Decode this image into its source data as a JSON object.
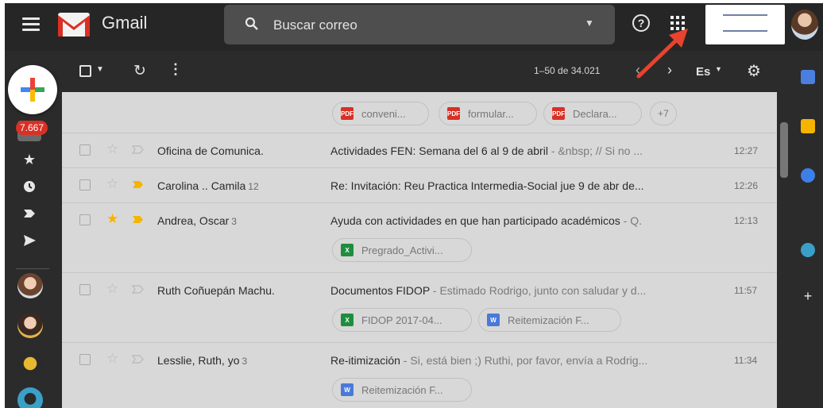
{
  "header": {
    "app_name": "Gmail",
    "search_placeholder": "Buscar correo",
    "icons": [
      "menu-icon",
      "search-icon",
      "help-icon",
      "apps-icon"
    ]
  },
  "nav": {
    "inbox_badge": "7.667",
    "icons": [
      "star-icon",
      "clock-icon",
      "label-icon",
      "send-icon"
    ]
  },
  "toolbar": {
    "page_count": "1–50 de 34.021",
    "language": "Es",
    "icons": [
      "select-checkbox",
      "refresh-icon",
      "more-icon",
      "chevron-left-icon",
      "chevron-right-icon",
      "gear-icon"
    ]
  },
  "prev_row_attachments": [
    {
      "type": "PDF",
      "name": "conveni..."
    },
    {
      "type": "PDF",
      "name": "formular..."
    },
    {
      "type": "PDF",
      "name": "Declara..."
    }
  ],
  "prev_row_more": "+7",
  "emails": [
    {
      "sender": "Oficina de Comunica.",
      "count": "",
      "subject": "Actividades FEN: Semana del 6 al 9 de abril",
      "snippet": " - &nbsp; // Si no ...",
      "time": "12:27",
      "starred": false,
      "important": false
    },
    {
      "sender": "Carolina .. Camila",
      "count": "12",
      "subject": "Re: Invitación: Reu Practica Intermedia-Social jue 9 de abr de...",
      "snippet": "",
      "time": "12:26",
      "starred": false,
      "important": true
    },
    {
      "sender": "Andrea, Oscar",
      "count": "3",
      "subject": "Ayuda con actividades en que han participado académicos",
      "snippet": " - Q.",
      "time": "12:13",
      "starred": true,
      "important": true,
      "attachments": [
        {
          "type": "X",
          "name": "Pregrado_Activi..."
        }
      ]
    },
    {
      "sender": "Ruth Coñuepán Machu.",
      "count": "",
      "subject": "Documentos FIDOP",
      "snippet": " - Estimado Rodrigo, junto con saludar y d...",
      "time": "11:57",
      "starred": false,
      "important": false,
      "attachments": [
        {
          "type": "X",
          "name": "FIDOP 2017-04..."
        },
        {
          "type": "W",
          "name": "Reitemización F..."
        }
      ]
    },
    {
      "sender": "Lesslie, Ruth, yo",
      "count": "3",
      "subject": "Re-itimización",
      "snippet": " - Si, está bien ;) Ruthi, por favor, envía a Rodrig...",
      "time": "11:34",
      "starred": false,
      "important": false,
      "attachments": [
        {
          "type": "W",
          "name": "Reitemización F..."
        }
      ]
    }
  ],
  "colors": {
    "topbar": "#262626",
    "list_bg": "#d8d8d8",
    "star": "#f5b400",
    "badge": "#d93025",
    "arrow": "#e8432e",
    "pdf": "#d93025",
    "sheets": "#1e8e3e",
    "docs": "#4a79d9"
  }
}
